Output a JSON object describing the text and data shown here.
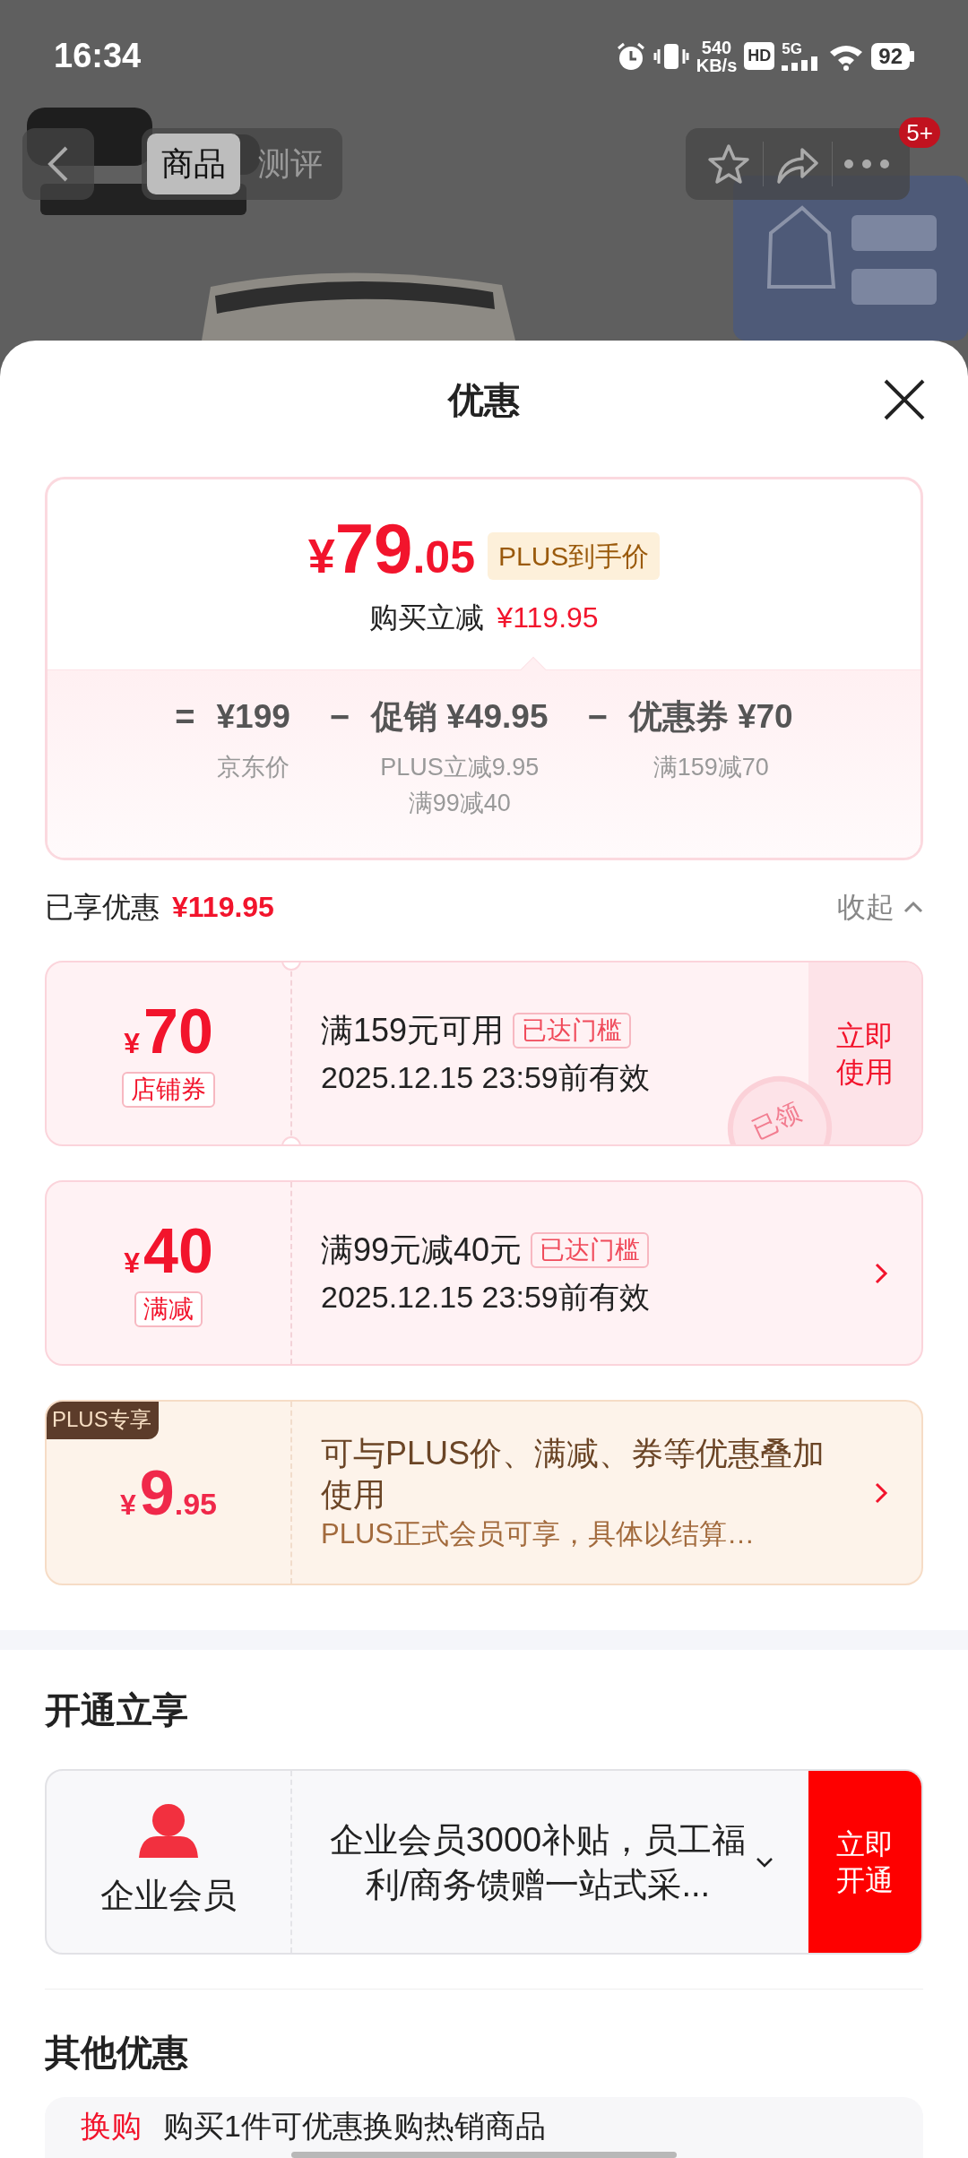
{
  "status_bar": {
    "time": "16:34",
    "net_speed": "540",
    "net_unit": "KB/s",
    "hd": "HD",
    "network": "5G",
    "battery": "92"
  },
  "nav": {
    "tabs": [
      {
        "label": "商品",
        "selected": true
      },
      {
        "label": "测评",
        "selected": false
      }
    ],
    "badge": "5+"
  },
  "sheet": {
    "title": "优惠"
  },
  "price_card": {
    "currency": "¥",
    "integer": "79",
    "decimal": ".05",
    "tag": "PLUS到手价",
    "saving_label": "购买立减",
    "saving": "¥119.95",
    "formula": [
      {
        "op": "=",
        "value": "¥199",
        "notes": [
          "京东价"
        ]
      },
      {
        "op": "−",
        "value": "促销 ¥49.95",
        "notes": [
          "PLUS立减9.95",
          "满99减40"
        ]
      },
      {
        "op": "−",
        "value": "优惠券 ¥70",
        "notes": [
          "满159减70"
        ]
      }
    ]
  },
  "enjoyed": {
    "label": "已享优惠",
    "amount": "¥119.95",
    "toggle": "收起",
    "expanded": true
  },
  "coupons": [
    {
      "kind": "store",
      "currency": "¥",
      "amount": "70",
      "type": "店铺券",
      "title": "满159元可用",
      "tag": "已达门槛",
      "validity": "2025.12.15 23:59前有效",
      "action": "立即使用",
      "stamp": "已领"
    },
    {
      "kind": "discount",
      "currency": "¥",
      "amount": "40",
      "type": "满减",
      "title": "满99元减40元",
      "tag": "已达门槛",
      "validity": "2025.12.15 23:59前有效"
    },
    {
      "kind": "plus",
      "ribbon": "PLUS专享",
      "currency": "¥",
      "amount": "9",
      "decimal": ".95",
      "title": "可与PLUS价、满减、券等优惠叠加使用",
      "subtitle": "PLUS正式会员可享，具体以结算…"
    }
  ],
  "open_section": {
    "title": "开通立享",
    "offer": {
      "name": "企业会员",
      "description": "企业会员3000补贴，员工福利/商务馈赠一站式采...",
      "action": "立即开通"
    }
  },
  "other_section": {
    "title": "其他优惠",
    "items": [
      {
        "tag": "换购",
        "text": "购买1件可优惠换购热销商品"
      }
    ]
  }
}
